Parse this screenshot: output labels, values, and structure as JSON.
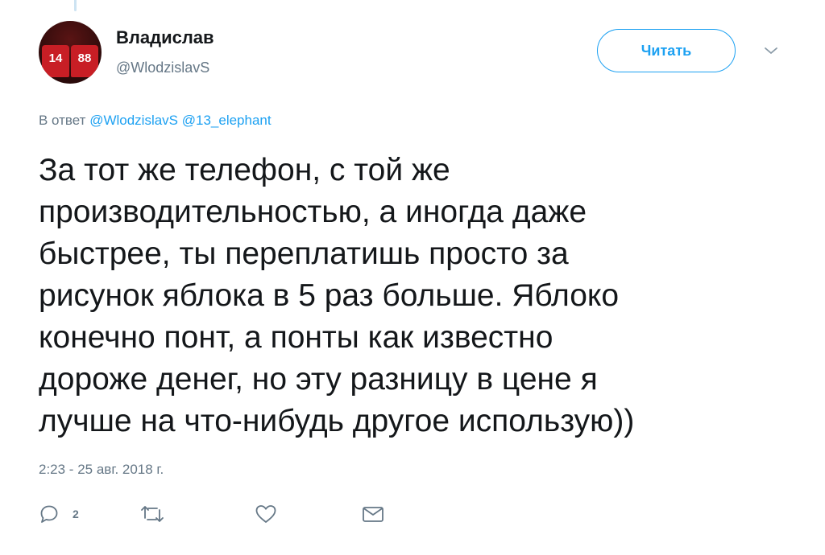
{
  "author": {
    "display_name": "Владислав",
    "handle": "@WlodzislavS",
    "avatar_jersey_numbers": [
      "14",
      "88"
    ]
  },
  "follow_button": {
    "label": "Читать"
  },
  "reply_context": {
    "prefix": "В ответ",
    "mentions": "@WlodzislavS @13_elephant"
  },
  "tweet": {
    "text": "За тот же телефон, с той же\nпроизводительностью, а  иногда даже\nбыстрее, ты переплатишь  просто за\nрисунок яблока в 5 раз больше. Яблоко\nконечно понт, а понты как известно\nдороже денег, но эту разницу в цене я\nлучше на что-нибудь другое использую))",
    "timestamp": "2:23 - 25 авг. 2018 г."
  },
  "actions": {
    "reply_count": "2"
  },
  "colors": {
    "accent": "#1da1f2",
    "secondary_text": "#657786",
    "primary_text": "#14171a"
  }
}
